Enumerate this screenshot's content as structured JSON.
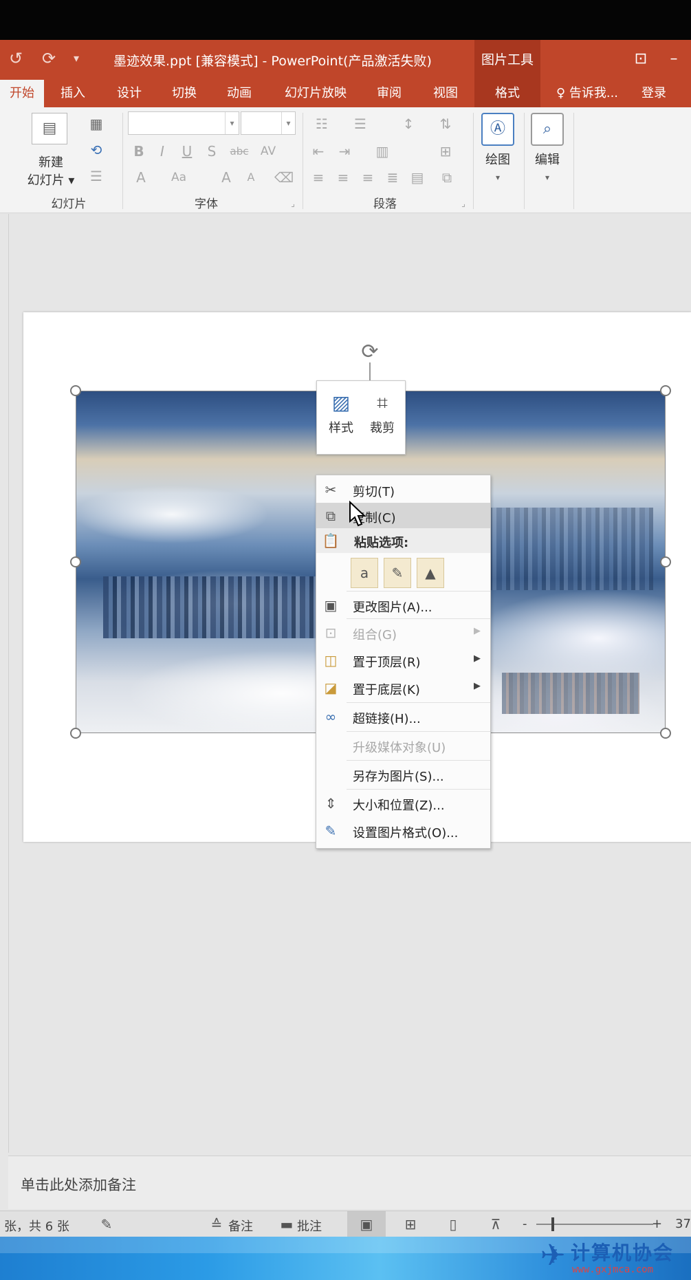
{
  "titlebar": {
    "title": "墨迹效果.ppt [兼容模式] - PowerPoint(产品激活失败)",
    "context_group": "图片工具",
    "restore_icon": "ribbon-display-icon",
    "minimize_label": "–"
  },
  "tabs": [
    {
      "label": "开始"
    },
    {
      "label": "插入"
    },
    {
      "label": "设计"
    },
    {
      "label": "切换"
    },
    {
      "label": "动画"
    },
    {
      "label": "幻灯片放映"
    },
    {
      "label": "审阅"
    },
    {
      "label": "视图"
    },
    {
      "label": "格式"
    },
    {
      "label": "♀ 告诉我..."
    },
    {
      "label": "登录"
    }
  ],
  "ribbon": {
    "slides_group": {
      "new_slide_line1": "新建",
      "new_slide_line2": "幻灯片 ▾",
      "label": "幻灯片"
    },
    "font_group": {
      "label": "字体",
      "bold": "B",
      "italic": "I",
      "underline": "U",
      "shadow": "S",
      "strike": "abc",
      "spacing": "AV",
      "grow": "A",
      "shrink": "A",
      "case": "Aa",
      "color": "A"
    },
    "paragraph_group": {
      "label": "段落"
    },
    "drawing": {
      "label": "绘图"
    },
    "editing": {
      "label": "编辑"
    }
  },
  "mini_toolbar": {
    "style_label": "样式",
    "crop_label": "裁剪"
  },
  "context_menu": {
    "items": [
      {
        "label": "剪切(T)"
      },
      {
        "label": "复制(C)"
      },
      {
        "label": "粘贴选项:"
      },
      {
        "label": "更改图片(A)..."
      },
      {
        "label": "组合(G)"
      },
      {
        "label": "置于顶层(R)"
      },
      {
        "label": "置于底层(K)"
      },
      {
        "label": "超链接(H)..."
      },
      {
        "label": "升级媒体对象(U)"
      },
      {
        "label": "另存为图片(S)..."
      },
      {
        "label": "大小和位置(Z)..."
      },
      {
        "label": "设置图片格式(O)..."
      }
    ],
    "paste_options": [
      "a",
      "✎",
      "▲"
    ]
  },
  "notes": {
    "placeholder": "单击此处添加备注"
  },
  "statusbar": {
    "slide_info": "张，共 6 张",
    "notes_label": "备注",
    "comments_label": "批注",
    "zoom_minus": "-",
    "zoom_plus": "+",
    "zoom_value": "37"
  },
  "watermark": {
    "text": "计算机协会",
    "url": "www.gxjmca.com"
  },
  "colors": {
    "accent": "#c0462a",
    "context_tab": "#a8371f",
    "ribbon_bg": "#f3f3f3",
    "workspace_bg": "#e6e6e6"
  }
}
